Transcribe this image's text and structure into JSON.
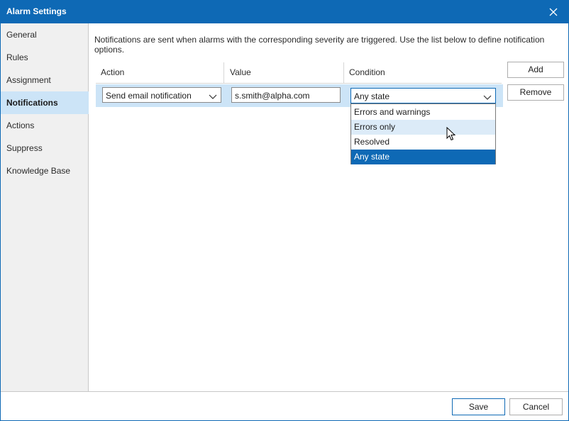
{
  "window": {
    "title": "Alarm Settings"
  },
  "sidebar": {
    "items": [
      {
        "label": "General"
      },
      {
        "label": "Rules"
      },
      {
        "label": "Assignment"
      },
      {
        "label": "Notifications",
        "active": true
      },
      {
        "label": "Actions"
      },
      {
        "label": "Suppress"
      },
      {
        "label": "Knowledge Base"
      }
    ]
  },
  "main": {
    "description": "Notifications are sent when alarms with the corresponding severity are triggered. Use the list below to define notification options.",
    "columns": [
      "Action",
      "Value",
      "Condition"
    ],
    "row": {
      "action": "Send email notification",
      "value": "s.smith@alpha.com",
      "condition": "Any state"
    },
    "condition_options": [
      "Errors and warnings",
      "Errors only",
      "Resolved",
      "Any state"
    ],
    "hovered_option": "Errors only",
    "selected_option": "Any state"
  },
  "buttons": {
    "add": "Add",
    "remove": "Remove",
    "save": "Save",
    "cancel": "Cancel"
  },
  "colors": {
    "accent": "#0e69b5",
    "selection": "#cce4f7",
    "hover": "#dcebf8"
  }
}
